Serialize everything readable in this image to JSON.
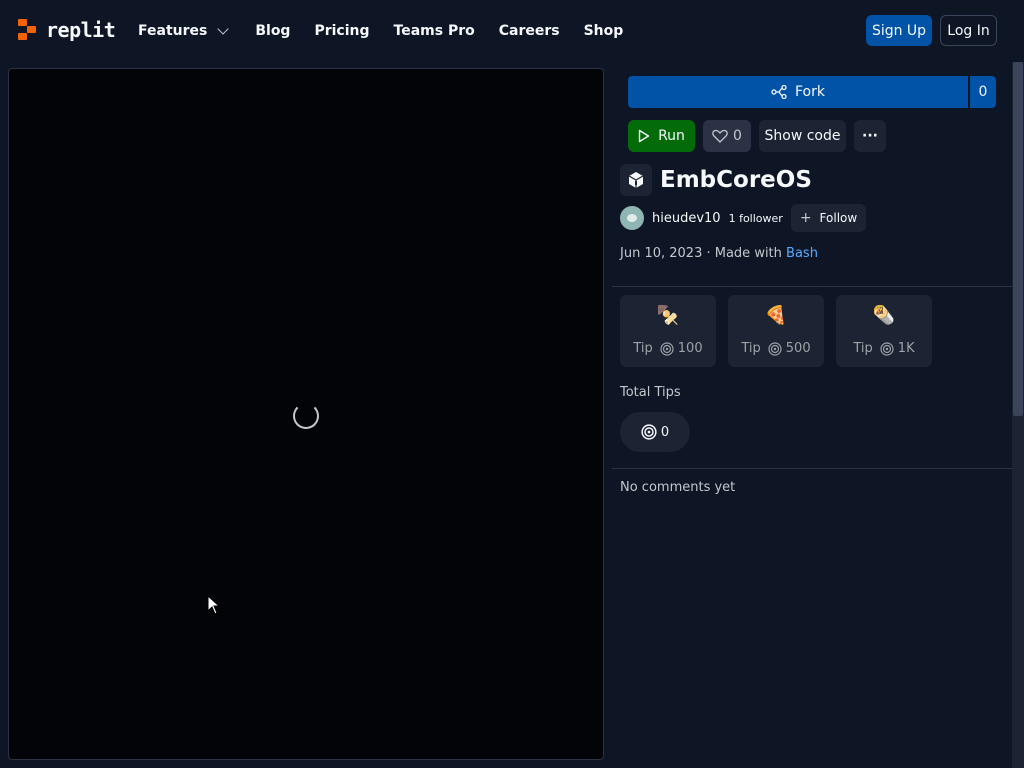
{
  "header": {
    "brand": "replit",
    "nav": [
      {
        "label": "Features"
      },
      {
        "label": "Blog"
      },
      {
        "label": "Pricing"
      },
      {
        "label": "Teams Pro"
      },
      {
        "label": "Careers"
      },
      {
        "label": "Shop"
      }
    ],
    "signup_label": "Sign Up",
    "login_label": "Log In"
  },
  "repl": {
    "fork_label": "Fork",
    "fork_count": "0",
    "run_label": "Run",
    "like_count": "0",
    "show_code_label": "Show code",
    "more_label": "···",
    "title": "EmbCoreOS",
    "author": "hieudev10",
    "followers": "1 follower",
    "follow_label": "Follow",
    "date": "Jun 10, 2023",
    "made_with_prefix": "· Made with",
    "language": "Bash"
  },
  "tips": [
    {
      "emoji": "🍢",
      "label": "Tip",
      "amount": "100"
    },
    {
      "emoji": "🍕",
      "label": "Tip",
      "amount": "500"
    },
    {
      "emoji": "🌯",
      "label": "Tip",
      "amount": "1K"
    }
  ],
  "total_tips": {
    "label": "Total Tips",
    "value": "0"
  },
  "comments": {
    "empty_text": "No comments yet"
  },
  "colors": {
    "background": "#0e1525",
    "primary": "#0053a6",
    "run": "#036c09",
    "accent_orange": "#f26207",
    "link": "#57abff"
  },
  "icons": [
    "replit-logo-icon",
    "chevron-down-icon",
    "fork-icon",
    "play-icon",
    "heart-icon",
    "ellipsis-icon",
    "repl-icon",
    "plus-icon",
    "cycles-icon",
    "loading-spinner-icon",
    "mouse-cursor-icon"
  ]
}
